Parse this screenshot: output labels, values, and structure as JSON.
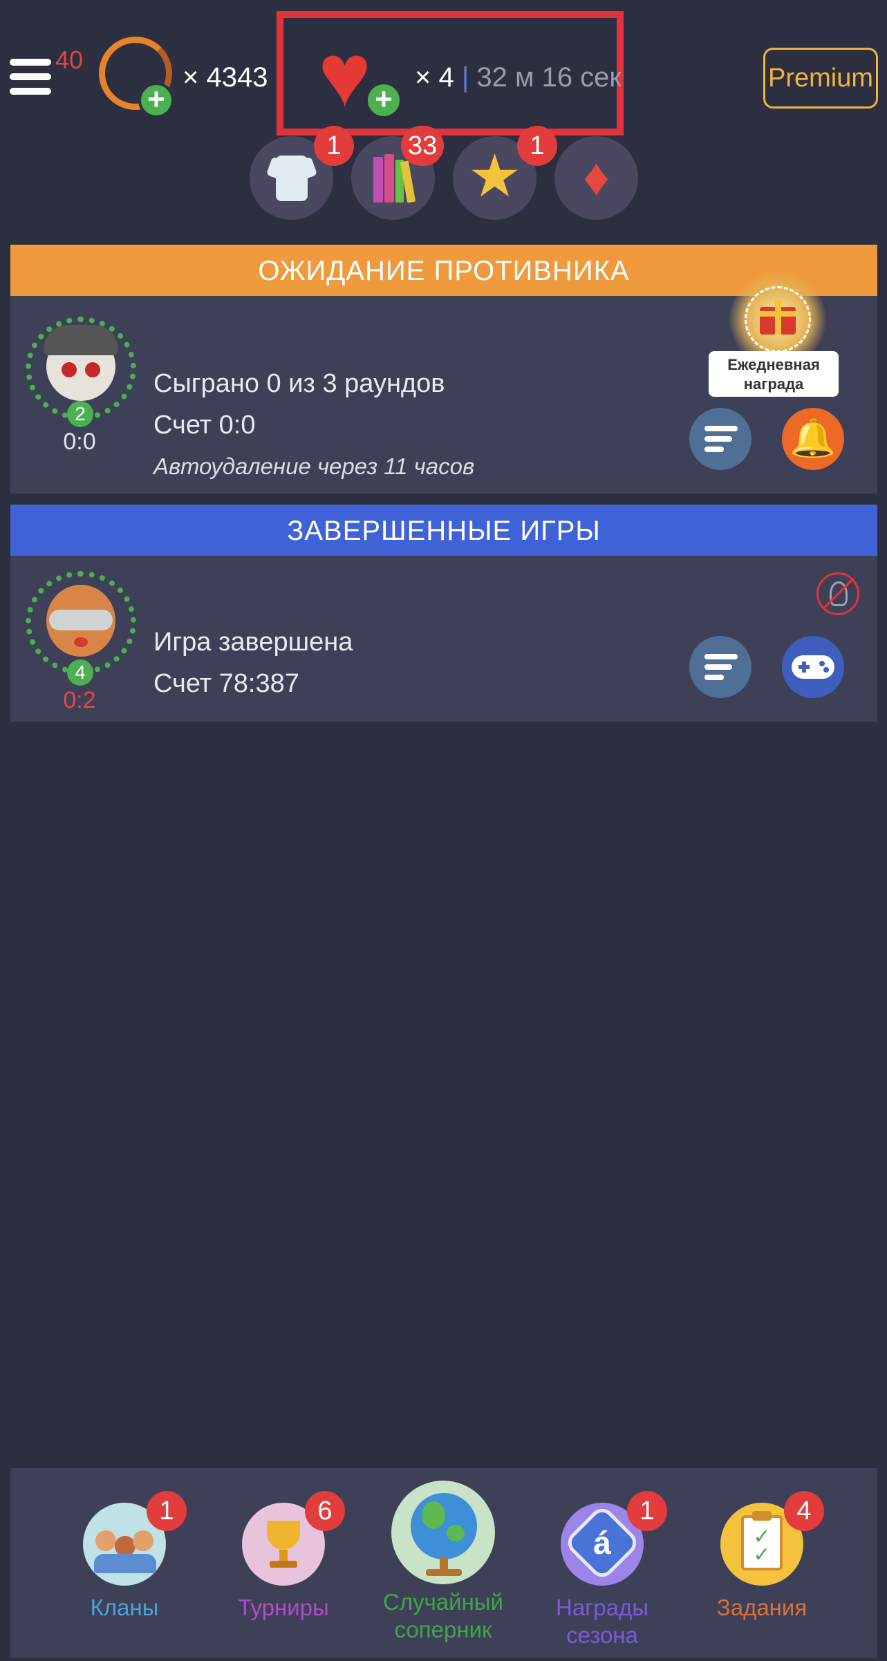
{
  "header": {
    "menu_count": "40",
    "coins": "× 4343",
    "lives": "× 4",
    "separator": "|",
    "timer": "32 м 16 сек",
    "premium_label": "Premium"
  },
  "shop": {
    "shirt_badge": "1",
    "books_badge": "33",
    "star_badge": "1"
  },
  "waiting": {
    "header": "ОЖИДАНИЕ ПРОТИВНИКА",
    "level": "2",
    "score_small": "0:0",
    "rounds": "Сыграно 0 из 3 раундов",
    "score": "Счет 0:0",
    "autodelete": "Автоудаление через 11 часов",
    "daily_reward_line1": "Ежедневная",
    "daily_reward_line2": "награда"
  },
  "finished": {
    "header": "ЗАВЕРШЕННЫЕ ИГРЫ",
    "level": "4",
    "score_small": "0:2",
    "status": "Игра завершена",
    "score": "Счет 78:387"
  },
  "bottom_nav": [
    {
      "label": "Кланы",
      "badge": "1",
      "color": "#4aa3d6"
    },
    {
      "label": "Турниры",
      "badge": "6",
      "color": "#b04ac8"
    },
    {
      "label": "Случайный соперник",
      "badge": "",
      "color": "#3fa64a"
    },
    {
      "label": "Награды сезона",
      "badge": "1",
      "color": "#7a5bd6"
    },
    {
      "label": "Задания",
      "badge": "4",
      "color": "#d9713a"
    }
  ],
  "colors": {
    "background": "#2c2f40",
    "panel": "#3e4057",
    "waiting_header": "#ef9a3c",
    "finished_header": "#3f63d6",
    "badge": "#e23c3c",
    "premium": "#f2b33d",
    "highlight": "#e2333c"
  }
}
